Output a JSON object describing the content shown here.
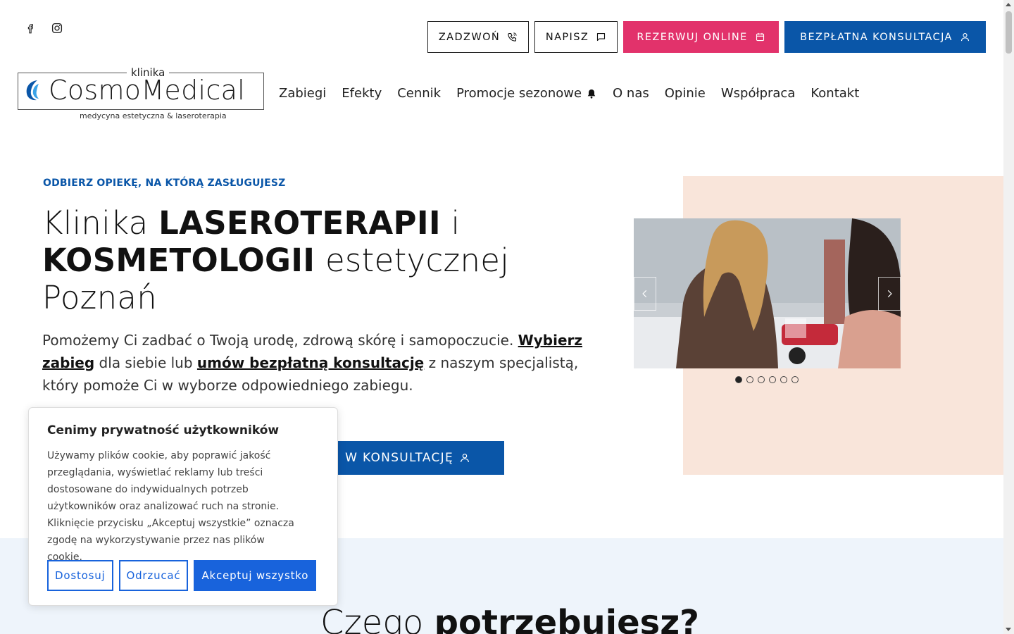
{
  "social": {
    "facebook_icon": "facebook-icon",
    "instagram_icon": "instagram-icon"
  },
  "top_buttons": {
    "call": "ZADZWOŃ",
    "write": "NAPISZ",
    "book": "REZERWUJ ONLINE",
    "consult": "BEZPŁATNA KONSULTACJA"
  },
  "logo": {
    "prefix": "klinika",
    "name": "CosmoMedical",
    "tagline": "medycyna estetyczna & laseroterapia"
  },
  "nav": {
    "items": [
      "Zabiegi",
      "Efekty",
      "Cennik",
      "Promocje sezonowe",
      "O nas",
      "Opinie",
      "Współpraca",
      "Kontakt"
    ]
  },
  "hero": {
    "eyebrow": "ODBIERZ OPIEKĘ, NA KTÓRĄ ZASŁUGUJESZ",
    "title_1": "Klinika ",
    "title_2": "LASEROTERAPII",
    "title_3": " i ",
    "title_4": "KOSMETOLOGII",
    "title_5": " estetycznej Poznań",
    "intro_1": "Pomożemy Ci zadbać o Twoją urodę, zdrową skórę i samopoczucie. ",
    "intro_link1": "Wybierz zabieg",
    "intro_2": " dla siebie lub ",
    "intro_link2": "umów bezpłatną konsultację",
    "intro_3": " z naszym specjalistą, który pomoże Ci w wyborze odpowiedniego zabiegu.",
    "cta": "W KONSULTACJĘ"
  },
  "slider": {
    "slides": 6,
    "active": 1
  },
  "section2": {
    "title_1": "Czego ",
    "title_2": "potrzebujesz?"
  },
  "cookie": {
    "title": "Cenimy prywatność użytkowników",
    "text": "Używamy plików cookie, aby poprawić jakość przeglądania, wyświetlać reklamy lub treści dostosowane do indywidualnych potrzeb użytkowników oraz analizować ruch na stronie. Kliknięcie przycisku „Akceptuj wszystkie” oznacza zgodę na wykorzystywanie przez nas plików cookie.",
    "customize": "Dostosuj",
    "reject": "Odrzucać",
    "accept": "Akceptuj wszystko"
  },
  "colors": {
    "blue": "#0a56a8",
    "pink": "#e2326b",
    "peach": "#f9e5da",
    "light_blue": "#eef4fb",
    "cookie_blue": "#1863dc"
  }
}
